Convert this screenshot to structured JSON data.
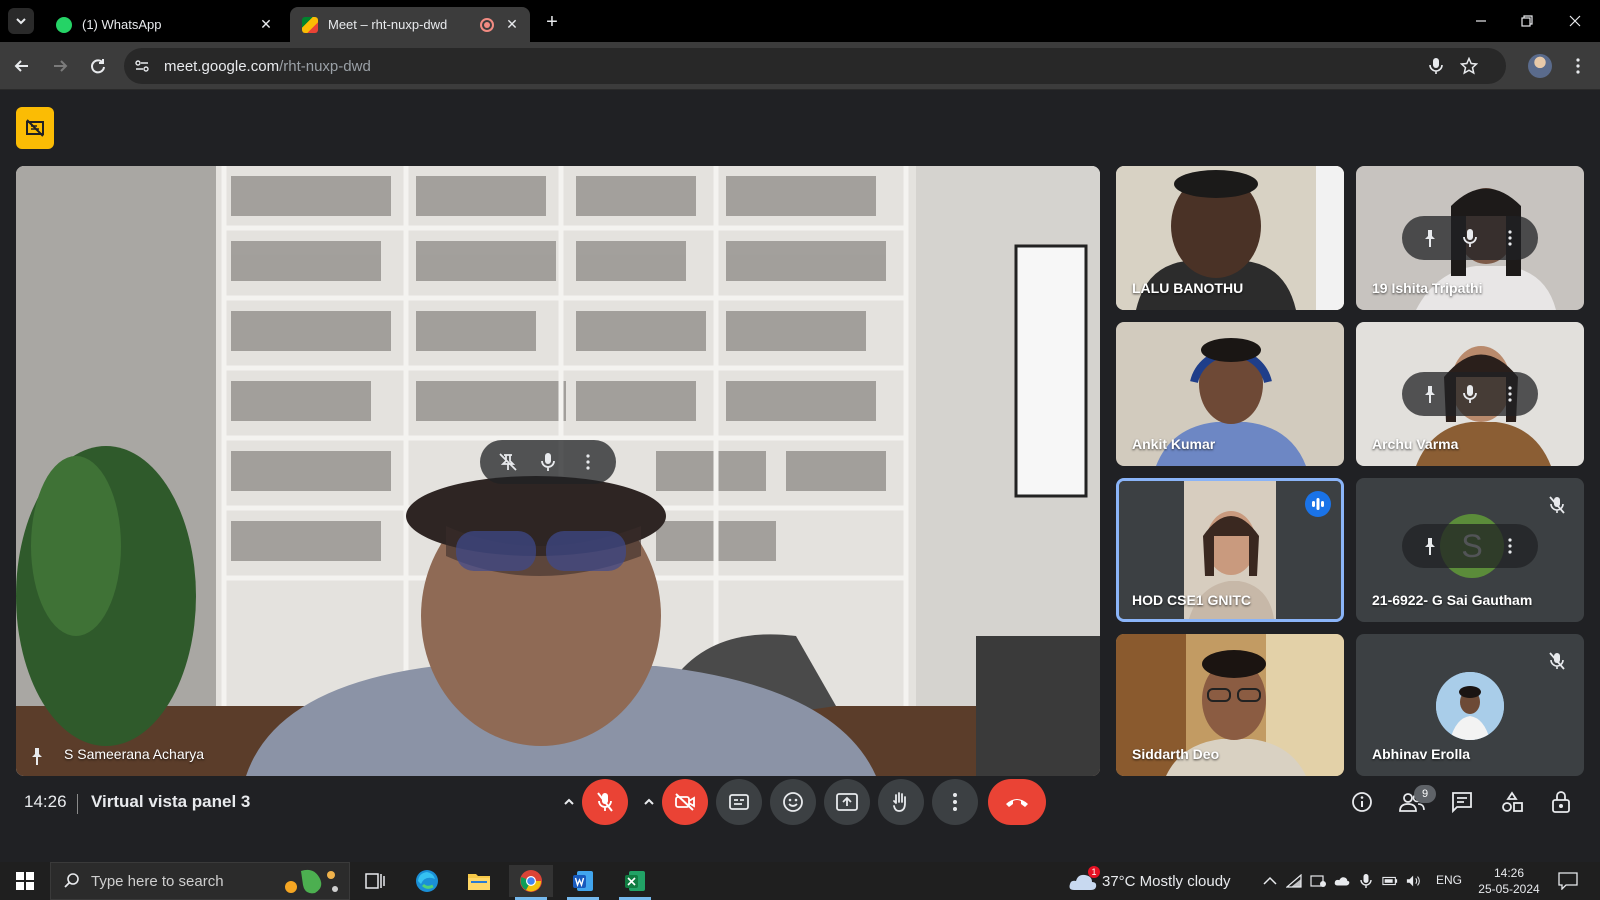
{
  "browser": {
    "tabs": [
      {
        "title": "(1) WhatsApp",
        "active": false
      },
      {
        "title": "Meet – rht-nuxp-dwd",
        "active": true
      }
    ],
    "url_host": "meet.google.com",
    "url_path": "/rht-nuxp-dwd"
  },
  "meet": {
    "main_speaker": {
      "name": "S Sameerana Acharya",
      "pinned": true
    },
    "participants": [
      {
        "name": "LALU BANOTHU"
      },
      {
        "name": "19 Ishita Tripathi"
      },
      {
        "name": "Ankit Kumar"
      },
      {
        "name": "Archu Varma"
      },
      {
        "name": "HOD CSE1 GNITC",
        "speaking": true
      },
      {
        "name": "21-6922- G Sai Gautham",
        "avatar_letter": "S",
        "muted": true
      },
      {
        "name": "Siddarth Deo"
      },
      {
        "name": "Abhinav Erolla",
        "muted": true
      }
    ],
    "bottom_bar": {
      "time": "14:26",
      "meeting_name": "Virtual vista panel 3",
      "participant_count": "9"
    },
    "colors": {
      "end_call": "#ea4335",
      "muted": "#ea4335",
      "active_border": "#8ab4f8",
      "recording": "#fbbc04",
      "speaking": "#1a73e8"
    }
  },
  "taskbar": {
    "search_placeholder": "Type here to search",
    "weather": "37°C  Mostly cloudy",
    "language": "ENG",
    "clock_time": "14:26",
    "clock_date": "25-05-2024",
    "weather_badge": "1"
  }
}
